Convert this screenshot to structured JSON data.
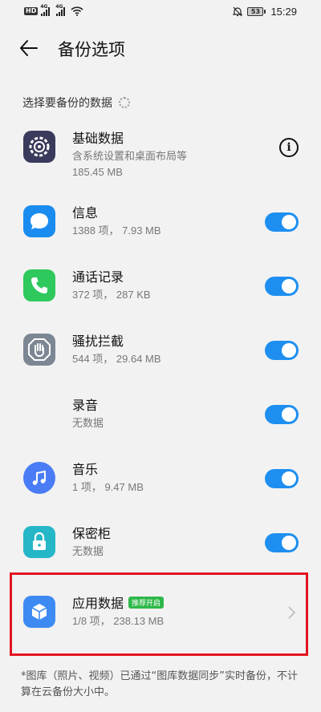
{
  "status_bar": {
    "hd_label": "HD",
    "signal1_tag": "4G",
    "signal2_tag": "4G",
    "battery_level": "53",
    "time": "15:29"
  },
  "header": {
    "title": "备份选项"
  },
  "section": {
    "title": "选择要备份的数据"
  },
  "items": [
    {
      "title": "基础数据",
      "subtitle": "含系统设置和桌面布局等",
      "detail": "185.45 MB",
      "icon": "gear-icon",
      "control": "info",
      "icon_color": "#3a3a5c"
    },
    {
      "title": "信息",
      "subtitle": "1388 项， 7.93 MB",
      "icon": "message-icon",
      "control": "toggle",
      "enabled": true,
      "icon_color": "#1a8cf0"
    },
    {
      "title": "通话记录",
      "subtitle": "372 项， 287 KB",
      "icon": "phone-icon",
      "control": "toggle",
      "enabled": true,
      "icon_color": "#2ec95c"
    },
    {
      "title": "骚扰拦截",
      "subtitle": "544 项， 29.64 MB",
      "icon": "block-hand-icon",
      "control": "toggle",
      "enabled": true,
      "icon_color": "#7d8794"
    },
    {
      "title": "录音",
      "subtitle": "无数据",
      "icon": "soundwave-icon",
      "control": "toggle",
      "enabled": true,
      "icon_color": "#8a5cf0"
    },
    {
      "title": "音乐",
      "subtitle": "1 项， 9.47 MB",
      "icon": "music-note-icon",
      "control": "toggle",
      "enabled": true,
      "icon_color": "#4a7cf5"
    },
    {
      "title": "保密柜",
      "subtitle": "无数据",
      "icon": "lock-icon",
      "control": "toggle",
      "enabled": true,
      "icon_color": "#25b6c8"
    },
    {
      "title": "应用数据",
      "badge": "推荐开启",
      "subtitle": "1/8 项， 238.13 MB",
      "icon": "app-cube-icon",
      "control": "chevron",
      "icon_color": "#3d8bf2"
    }
  ],
  "footnote": "*图库（照片、视频）已通过“图库数据同步”实时备份，不计算在云备份大小中。",
  "colors": {
    "toggle_on": "#1e8ff0",
    "highlight": "#e3141f",
    "badge": "#2fb84a"
  }
}
